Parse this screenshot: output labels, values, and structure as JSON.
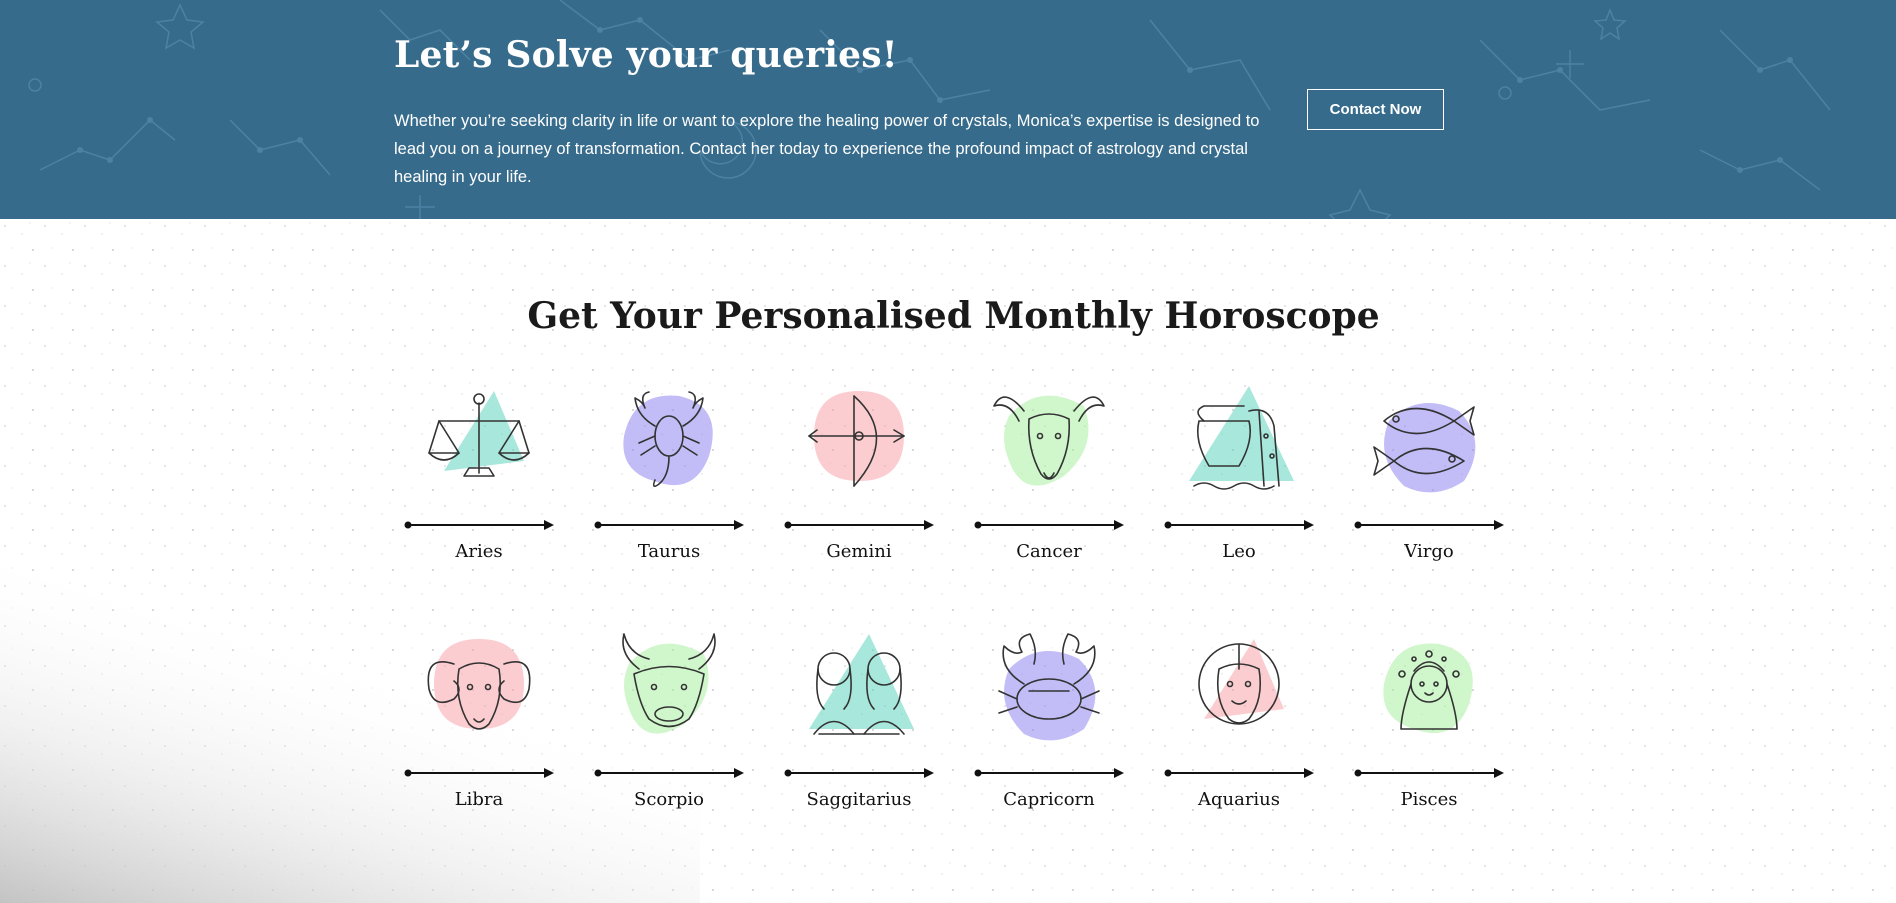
{
  "banner": {
    "title": "Let’s Solve your queries!",
    "description": "Whether you’re seeking clarity in life or want to explore the healing power of crystals, Monica’s expertise is designed to lead you on a journey of transformation. Contact her today to experience the profound impact of astrology and crystal healing in your life.",
    "button_label": "Contact Now",
    "background_color": "#366b8c"
  },
  "horoscope": {
    "title": "Get Your Personalised Monthly Horoscope",
    "signs": [
      {
        "name": "Aries",
        "icon": "libra-scales-icon",
        "color": "#5fd3bf"
      },
      {
        "name": "Taurus",
        "icon": "scorpion-icon",
        "color": "#8f86f0"
      },
      {
        "name": "Gemini",
        "icon": "bow-arrow-icon",
        "color": "#f7a4aa"
      },
      {
        "name": "Cancer",
        "icon": "goat-icon",
        "color": "#a9eea0"
      },
      {
        "name": "Leo",
        "icon": "water-jug-icon",
        "color": "#5fd3bf"
      },
      {
        "name": "Virgo",
        "icon": "two-fish-icon",
        "color": "#8f86f0"
      },
      {
        "name": "Libra",
        "icon": "ram-icon",
        "color": "#f7a4aa"
      },
      {
        "name": "Scorpio",
        "icon": "bull-icon",
        "color": "#a9eea0"
      },
      {
        "name": "Saggitarius",
        "icon": "twins-icon",
        "color": "#5fd3bf"
      },
      {
        "name": "Capricorn",
        "icon": "crab-icon",
        "color": "#8f86f0"
      },
      {
        "name": "Aquarius",
        "icon": "lion-icon",
        "color": "#f7a4aa"
      },
      {
        "name": "Pisces",
        "icon": "maiden-icon",
        "color": "#a9eea0"
      }
    ]
  }
}
